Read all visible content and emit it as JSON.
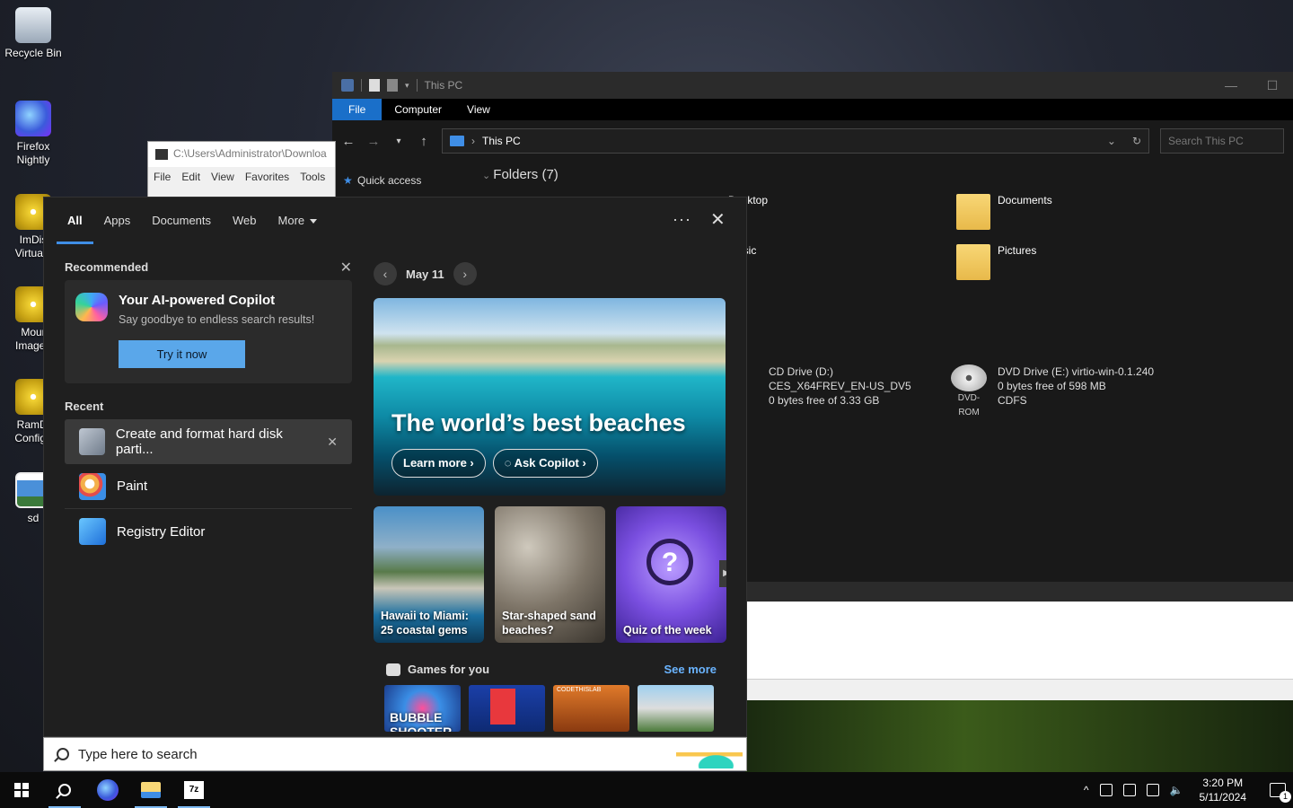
{
  "desktop": {
    "icons": [
      {
        "label": "Recycle Bin"
      },
      {
        "label": "Firefox Nightly"
      },
      {
        "label": "ImDis Virtual I"
      },
      {
        "label": "Mour Image I"
      },
      {
        "label": "RamDi Configu"
      },
      {
        "label": "sd"
      }
    ]
  },
  "explorer": {
    "title": "This PC",
    "ribbon_tabs": [
      "File",
      "Computer",
      "View"
    ],
    "address": "This PC",
    "search_placeholder": "Search This PC",
    "nav_items": [
      "Quick access"
    ],
    "folders_header": "Folders (7)",
    "folders": [
      "Desktop",
      "Documents",
      "Music",
      "Pictures"
    ],
    "drives": [
      {
        "name": "CD Drive (D:)",
        "label": "CES_X64FREV_EN-US_DV5",
        "free": "0 bytes free of 3.33 GB"
      },
      {
        "name": "DVD Drive (E:) virtio-win-0.1.240",
        "free": "0 bytes free of 598 MB",
        "fs": "CDFS",
        "badge": "DVD-ROM"
      }
    ]
  },
  "sevenzip": {
    "title": "C:\\Users\\Administrator\\Downloa",
    "menu": [
      "File",
      "Edit",
      "View",
      "Favorites",
      "Tools"
    ]
  },
  "search_panel": {
    "tabs": [
      "All",
      "Apps",
      "Documents",
      "Web",
      "More"
    ],
    "more_options": "···",
    "recommended": {
      "header": "Recommended",
      "card_title": "Your AI-powered Copilot",
      "card_sub": "Say goodbye to endless search results!",
      "button": "Try it now"
    },
    "recent": {
      "header": "Recent",
      "items": [
        "Create and format hard disk parti...",
        "Paint",
        "Registry Editor"
      ]
    },
    "highlights": {
      "date": "May 11",
      "hero_title": "The world’s best beaches",
      "learn_more": "Learn more",
      "ask_copilot": "Ask Copilot",
      "cards": [
        {
          "text": "Hawaii to Miami: 25 coastal gems"
        },
        {
          "text": "Star-shaped sand beaches?"
        },
        {
          "text": "Quiz of the week"
        }
      ],
      "games_header": "Games for you",
      "see_more": "See more",
      "games": [
        "BUBBLE SHOOTER",
        "",
        "CODETHISLAB",
        ""
      ]
    }
  },
  "searchbar": {
    "placeholder": "Type here to search"
  },
  "taskbar": {
    "time": "3:20 PM",
    "date": "5/11/2024",
    "notification_count": "1"
  }
}
